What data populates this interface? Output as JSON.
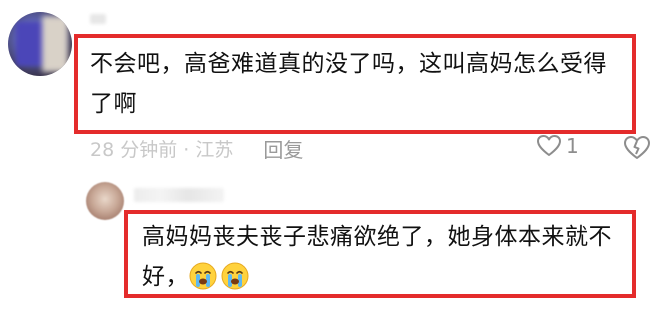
{
  "main_comment": {
    "text": "不会吧，高爸难道真的没了吗，这叫高妈怎么受得了啊",
    "time_location": "28 分钟前 · 江苏",
    "reply_label": "回复",
    "like_count": "1"
  },
  "reply_comment": {
    "text": "高妈妈丧夫丧子悲痛欲绝了，她身体本来就不好，",
    "emojis": [
      "crying-face-icon",
      "crying-face-icon"
    ]
  },
  "colors": {
    "highlight_border": "#e42b2b",
    "meta_text": "#c8c8c8",
    "reply_text": "#9a9a9a"
  }
}
